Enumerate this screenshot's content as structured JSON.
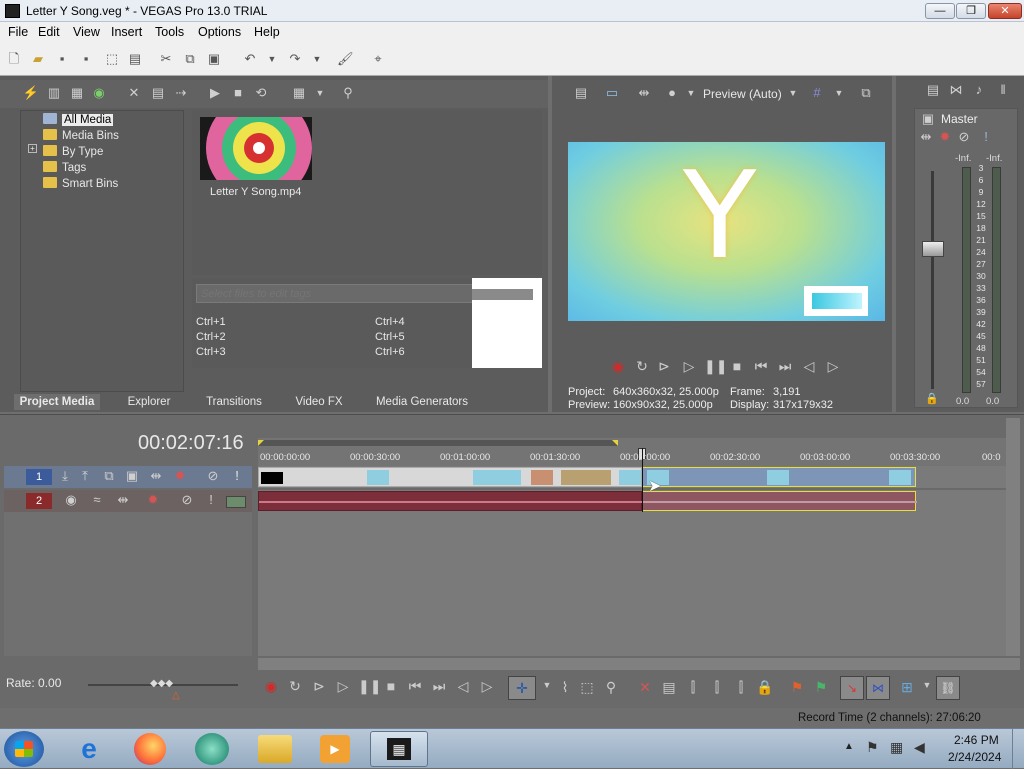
{
  "window": {
    "title": "Letter Y Song.veg * - VEGAS Pro 13.0 TRIAL",
    "buttons": {
      "minimize": "—",
      "maximize": "❐",
      "close": "✕"
    }
  },
  "menu": [
    "File",
    "Edit",
    "View",
    "Insert",
    "Tools",
    "Options",
    "Help"
  ],
  "media_tree": {
    "items": [
      "All Media",
      "Media Bins",
      "By Type",
      "Tags",
      "Smart Bins"
    ],
    "expand": "+"
  },
  "media_file": {
    "name": "Letter Y Song.mp4"
  },
  "tags": {
    "placeholder": "Select files to edit tags",
    "shortcuts": [
      "Ctrl+1",
      "Ctrl+2",
      "Ctrl+3",
      "Ctrl+4",
      "Ctrl+5",
      "Ctrl+6"
    ]
  },
  "tabs": [
    "Project Media",
    "Explorer",
    "Transitions",
    "Video FX",
    "Media Generators"
  ],
  "preview": {
    "mode": "Preview (Auto)",
    "letter": "Y",
    "project_label": "Project:",
    "project_value": "640x360x32, 25.000p",
    "frame_label": "Frame:",
    "frame_value": "3,191",
    "preview_label": "Preview:",
    "preview_value": "160x90x32, 25.000p",
    "display_label": "Display:",
    "display_value": "317x179x32"
  },
  "master": {
    "title": "Master",
    "inf_left": "-Inf.",
    "inf_right": "-Inf.",
    "scale": [
      "3",
      "6",
      "9",
      "12",
      "15",
      "18",
      "21",
      "24",
      "27",
      "30",
      "33",
      "36",
      "39",
      "42",
      "45",
      "48",
      "51",
      "54",
      "57"
    ],
    "bottom_left": "0.0",
    "bottom_right": "0.0"
  },
  "timeline": {
    "timecode": "00:02:07:16",
    "ruler": [
      "00:00:00:00",
      "00:00:30:00",
      "00:01:00:00",
      "00:01:30:00",
      "00:02:00:00",
      "00:02:30:00",
      "00:03:00:00",
      "00:03:30:00",
      "00:0"
    ],
    "track1": "1",
    "track2": "2",
    "rate": "Rate: 0.00",
    "record_time": "Record Time (2 channels): 27:06:20"
  },
  "taskbar": {
    "time": "2:46 PM",
    "date": "2/24/2024"
  },
  "colors": {
    "accent": "#c9001b",
    "timeline_bg": "#7a7a7a",
    "video_clip": "#7d96b8",
    "audio_clip": "#7c2e3a"
  }
}
